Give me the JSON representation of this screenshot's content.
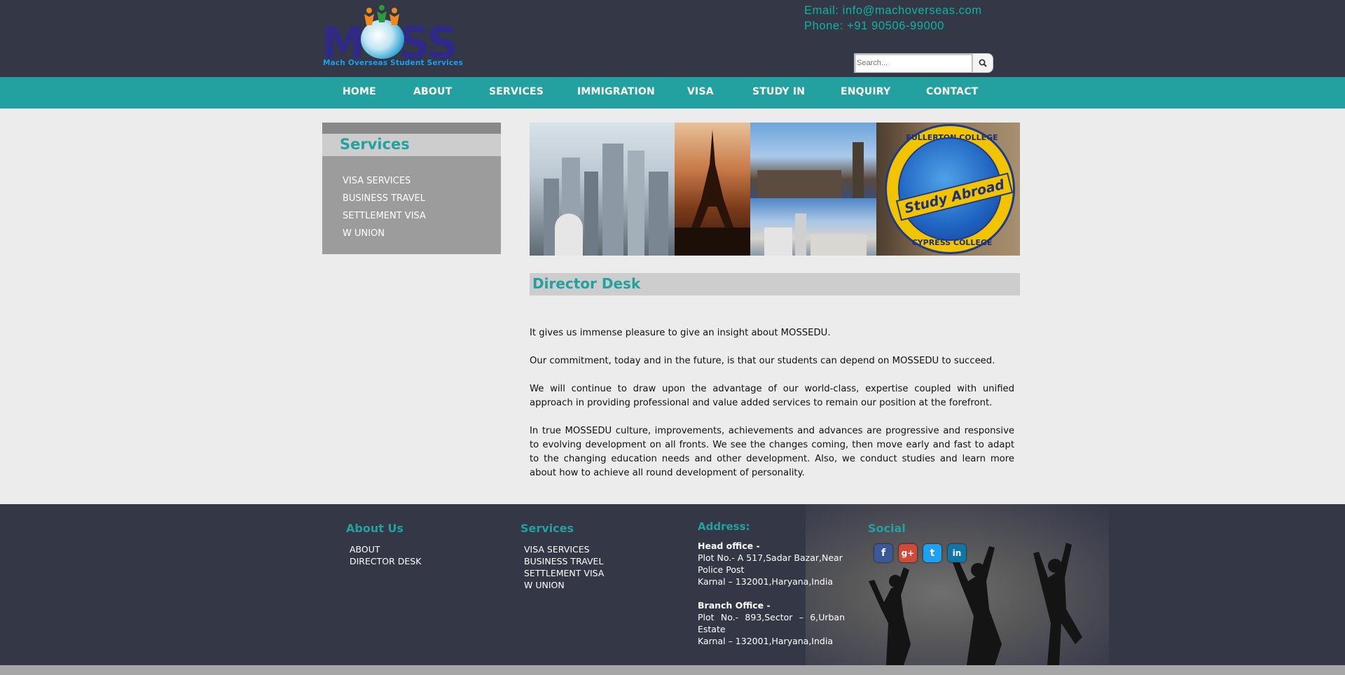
{
  "header": {
    "logo_text": "MOSS",
    "logo_subtext": "Mach Overseas Student Services",
    "email": "Email: info@machoverseas.com",
    "phone": "Phone: +91 90506-99000",
    "search_placeholder": "Search...",
    "search_icon": "search-icon"
  },
  "nav": {
    "items": [
      "HOME",
      "ABOUT",
      "SERVICES",
      "IMMIGRATION",
      "VISA",
      "STUDY IN",
      "ENQUIRY",
      "CONTACT"
    ]
  },
  "sidebar": {
    "title": "Services",
    "links": [
      "VISA SERVICES",
      "BUSINESS TRAVEL",
      "SETTLEMENT VISA",
      "W UNION"
    ]
  },
  "banner": {
    "badge_top": "FULLERTON COLLEGE",
    "badge_ribbon": "Study Abroad",
    "badge_bottom": "CYPRESS COLLEGE"
  },
  "main": {
    "title": "Director Desk",
    "paragraphs": [
      "It gives us immense pleasure to give an insight about MOSSEDU.",
      "Our commitment, today and in the future, is that our students can depend on MOSSEDU to succeed.",
      "We will continue to draw upon the advantage of our world-class, expertise coupled with unified approach in providing professional and value added services to remain our position at the forefront.",
      "In true MOSSEDU culture, improvements, achievements and advances are progressive and responsive to evolving development on all fronts. We see the changes coming, then move early and fast to adapt to the changing education needs and other development. Also, we conduct studies and learn more about how to achieve all round development of personality."
    ]
  },
  "footer": {
    "about": {
      "heading": "About Us",
      "links": [
        "ABOUT",
        "DIRECTOR DESK"
      ]
    },
    "services": {
      "heading": "Services",
      "links": [
        "VISA SERVICES",
        "BUSINESS TRAVEL",
        "SETTLEMENT VISA",
        "W UNION"
      ]
    },
    "address": {
      "heading": "Address:",
      "head_office_label": "Head office -",
      "head_office_line1": "Plot No.- A 517,Sadar Bazar,Near Police Post",
      "head_office_line2": "Karnal – 132001,Haryana,India",
      "branch_label": "Branch Office -",
      "branch_line1": "Plot No.- 893,Sector – 6,Urban Estate",
      "branch_line2": "Karnal – 132001,Haryana,India"
    },
    "social": {
      "heading": "Social",
      "icons": [
        {
          "name": "facebook-icon",
          "glyph": "f",
          "color": "#3b5998"
        },
        {
          "name": "google-plus-icon",
          "glyph": "g+",
          "color": "#d34836"
        },
        {
          "name": "twitter-icon",
          "glyph": "t",
          "color": "#1da1f2"
        },
        {
          "name": "linkedin-icon",
          "glyph": "in",
          "color": "#0e76a8"
        }
      ]
    }
  },
  "colors": {
    "header_bg": "#343746",
    "accent_teal": "#22a1a0",
    "body_bg": "#ececec",
    "sidebar_bg": "#9c9c9c"
  }
}
